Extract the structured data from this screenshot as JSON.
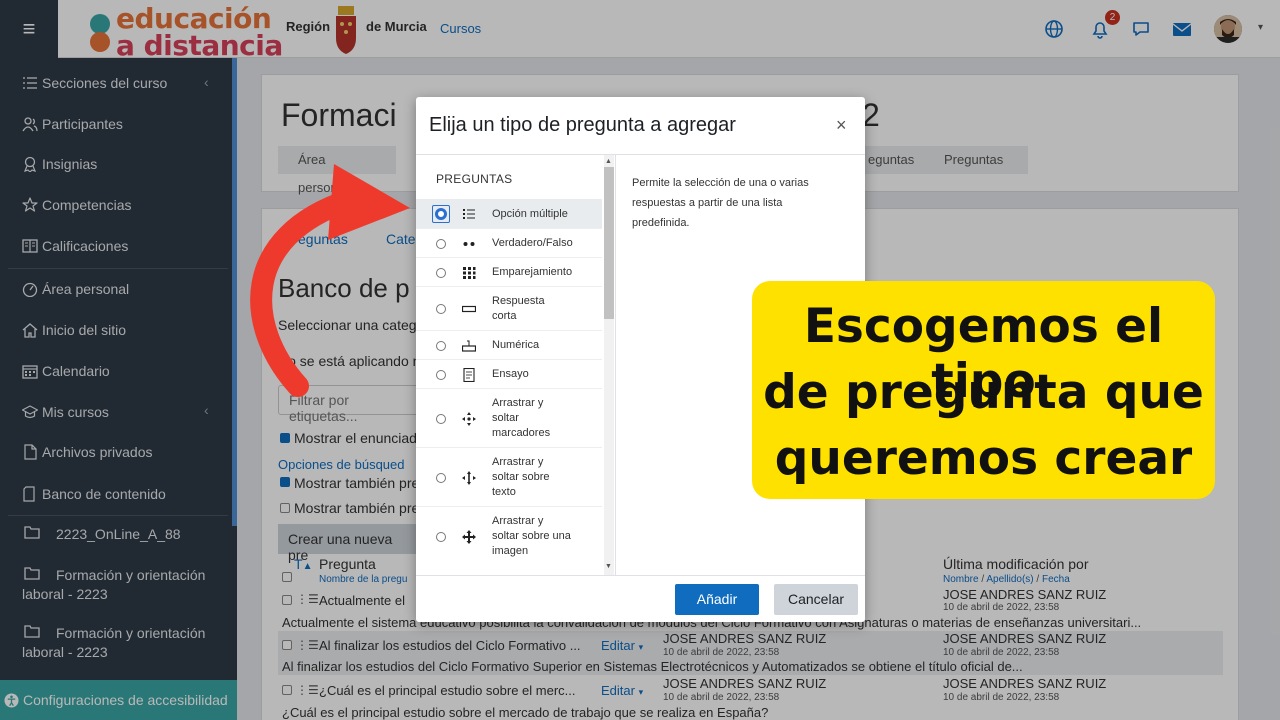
{
  "colors": {
    "accent": "#0f6cbf",
    "sidebar": "#2f3a46",
    "callout": "#ffe100",
    "arrow": "#ee3a2c",
    "badge": "#ca3120"
  },
  "header": {
    "logo_line1": "educación",
    "logo_line2": "a distancia",
    "region_left": "Región",
    "region_right": "de Murcia",
    "cursos_link": "Cursos",
    "notification_count": "2",
    "icons": [
      "language-icon",
      "bell-icon",
      "chat-icon",
      "mail-icon",
      "avatar"
    ]
  },
  "sidebar": {
    "items": [
      {
        "label": "Secciones del curso",
        "icon": "list-icon"
      },
      {
        "label": "Participantes",
        "icon": "users-icon"
      },
      {
        "label": "Insignias",
        "icon": "badge-icon"
      },
      {
        "label": "Competencias",
        "icon": "star-icon"
      },
      {
        "label": "Calificaciones",
        "icon": "grades-icon"
      },
      {
        "label": "Área personal",
        "icon": "dashboard-icon"
      },
      {
        "label": "Inicio del sitio",
        "icon": "home-icon"
      },
      {
        "label": "Calendario",
        "icon": "calendar-icon"
      },
      {
        "label": "Mis cursos",
        "icon": "graduation-icon"
      },
      {
        "label": "Archivos privados",
        "icon": "file-icon"
      },
      {
        "label": "Banco de contenido",
        "icon": "content-icon"
      }
    ],
    "folders": [
      "2223_OnLine_A_88",
      "Formación y orientación laboral - 2223",
      "Formación y orientación laboral - 2223"
    ],
    "accessibility": "Configuraciones de accesibilidad"
  },
  "page": {
    "title_start": "Formaci",
    "title_end": "2",
    "breadcrumbs": [
      "Área personal",
      "eguntas",
      "Preguntas"
    ],
    "tabs": [
      "eguntas",
      "Cate"
    ],
    "bank_title": "Banco de p",
    "select_category": "Seleccionar una categ",
    "no_filter": "No se está aplicando n",
    "filter_placeholder": "Filtrar por etiquetas...",
    "show_statement": "Mostrar el enunciado",
    "search_options": "Opciones de búsqued",
    "show_also_1": "Mostrar también pre",
    "show_also_2": "Mostrar también pre",
    "create_button": "Crear una nueva pre",
    "col_t": "T",
    "col_question": "Pregunta",
    "col_question_sub": "Nombre de la pregu",
    "col_modified": "Última modificación por",
    "col_modified_sub_1": "Nombre",
    "col_modified_sub_2": "Apellido(s)",
    "col_modified_sub_3": "Fecha",
    "rows": [
      {
        "name": "Actualmente el",
        "modifier": "JOSE ANDRES SANZ RUIZ",
        "date": "10 de abril de 2022, 23:58",
        "full": "Actualmente el sistema educativo posibilita la convalidación de módulos del Ciclo Formativo con Asignaturas o materias de enseñanzas universitari..."
      },
      {
        "name": "Al finalizar los estudios del Ciclo Formativo ...",
        "edit": "Editar",
        "creator": "JOSE ANDRES SANZ RUIZ",
        "creator_date": "10 de abril de 2022, 23:58",
        "modifier": "JOSE ANDRES SANZ RUIZ",
        "date": "10 de abril de 2022, 23:58",
        "full": "Al finalizar los estudios del Ciclo Formativo Superior en Sistemas Electrotécnicos y Automatizados se obtiene el título oficial de..."
      },
      {
        "name": "¿Cuál es el principal estudio sobre el merc...",
        "edit": "Editar",
        "creator": "JOSE ANDRES SANZ RUIZ",
        "creator_date": "10 de abril de 2022, 23:58",
        "modifier": "JOSE ANDRES SANZ RUIZ",
        "date": "10 de abril de 2022, 23:58",
        "full": "¿Cuál es el principal estudio sobre el mercado de trabajo que se realiza en España?"
      }
    ]
  },
  "modal": {
    "title": "Elija un tipo de pregunta a agregar",
    "close": "×",
    "section": "PREGUNTAS",
    "options": [
      {
        "label": "Opción múltiple",
        "icon": "multichoice-icon",
        "selected": true
      },
      {
        "label": "Verdadero/Falso",
        "icon": "truefalse-icon"
      },
      {
        "label": "Emparejamiento",
        "icon": "matching-icon"
      },
      {
        "label": "Respuesta corta",
        "icon": "shortanswer-icon"
      },
      {
        "label": "Numérica",
        "icon": "numerical-icon"
      },
      {
        "label": "Ensayo",
        "icon": "essay-icon"
      },
      {
        "label": "Arrastrar y soltar marcadores",
        "icon": "drag-markers-icon"
      },
      {
        "label": "Arrastrar y soltar sobre texto",
        "icon": "drag-text-icon"
      },
      {
        "label": "Arrastrar y soltar sobre una imagen",
        "icon": "drag-image-icon"
      }
    ],
    "description": "Permite la selección de una o varias respuestas a partir de una lista predefinida.",
    "add_button": "Añadir",
    "cancel_button": "Cancelar"
  },
  "callout": {
    "lines": [
      "Escogemos el tipo",
      "de pregunta que",
      "queremos crear"
    ]
  }
}
